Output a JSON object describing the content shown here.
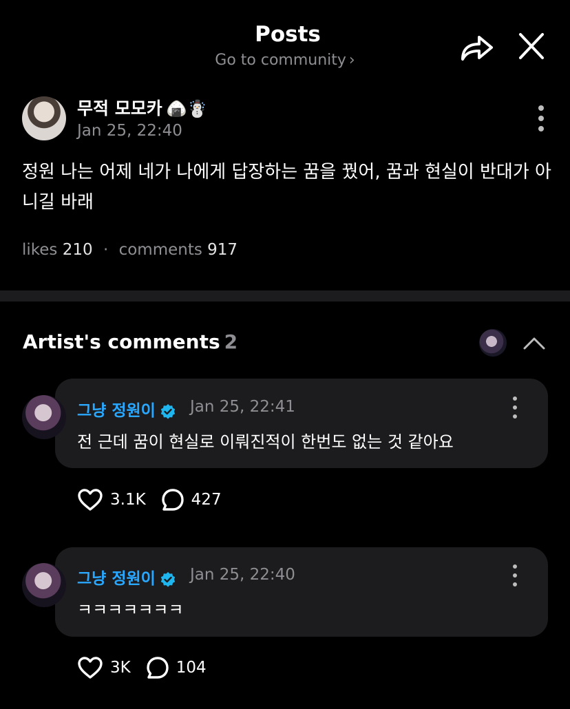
{
  "header": {
    "title": "Posts",
    "subtitle": "Go to community",
    "subtitle_chevron": "›",
    "share_icon": "share-arrow-icon",
    "close_icon": "close-icon"
  },
  "post": {
    "author": "무적 모모카",
    "author_emoji": "🍙☃️",
    "timestamp": "Jan 25, 22:40",
    "body": "정원 나는 어제 네가 나에게 답장하는 꿈을 꿨어, 꿈과 현실이 반대가 아니길 바래",
    "likes_label": "likes",
    "likes": "210",
    "separator": "·",
    "comments_label": "comments",
    "comments": "917"
  },
  "artist_section": {
    "title": "Artist's comments",
    "count": "2"
  },
  "comments": [
    {
      "name": "그냥 정원이",
      "timestamp": "Jan 25, 22:41",
      "text": "전 근데 꿈이 현실로 이뤄진적이 한번도 없는 것 같아요",
      "likes": "3.1K",
      "replies": "427"
    },
    {
      "name": "그냥 정원이",
      "timestamp": "Jan 25, 22:40",
      "text": "ㅋㅋㅋㅋㅋㅋㅋ",
      "likes": "3K",
      "replies": "104"
    }
  ],
  "colors": {
    "background": "#000000",
    "card": "#1c1c1e",
    "artist_name": "#2aa8ff",
    "muted": "#8e8e93"
  }
}
